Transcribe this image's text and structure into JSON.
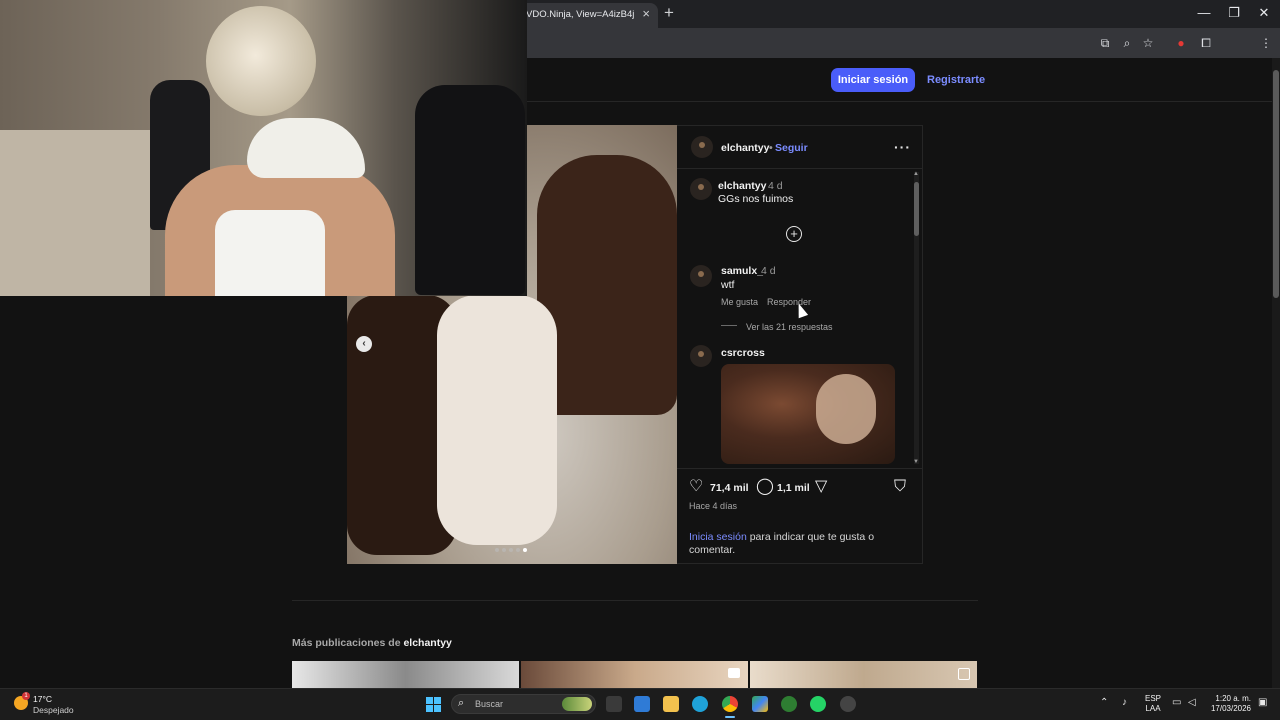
{
  "browser": {
    "tab_title": "VDO.Ninja, View=A4izB4j",
    "tab_close": "×",
    "new_tab": "+",
    "window": {
      "minimize": "—",
      "restore": "❐",
      "close": "✕"
    }
  },
  "header": {
    "login_button": "Iniciar sesión",
    "signup_link": "Registrarte"
  },
  "post": {
    "author": "elchantyy",
    "separator": "•",
    "follow": "Seguir",
    "more": "···",
    "carousel_prev": "‹",
    "comments": [
      {
        "user": "elchantyy",
        "time": "4 d",
        "text": "GGs nos fuimos"
      },
      {
        "user": "samulx_",
        "time": "4 d",
        "text": "wtf",
        "like": "Me gusta",
        "reply": "Responder",
        "view_replies": "Ver las 21 respuestas"
      },
      {
        "user": "csrcross",
        "has_media": true
      }
    ],
    "likes": "71,4 mil",
    "comments_count": "1,1 mil",
    "posted_ago": "Hace 4 días",
    "cta_link": "Inicia sesión",
    "cta_text": " para indicar que te gusta o comentar."
  },
  "more_posts": {
    "prefix": "Más publicaciones de ",
    "user": "elchantyy"
  },
  "taskbar": {
    "weather_badge": "1",
    "temp": "17°C",
    "weather_desc": "Despejado",
    "search_placeholder": "Buscar",
    "lang_line1": "ESP",
    "lang_line2": "LAA",
    "time": "1:20 a. m.",
    "date": "17/03/2026"
  },
  "colors": {
    "accent": "#4a5df9",
    "link": "#7b8cff",
    "background": "#121212"
  }
}
